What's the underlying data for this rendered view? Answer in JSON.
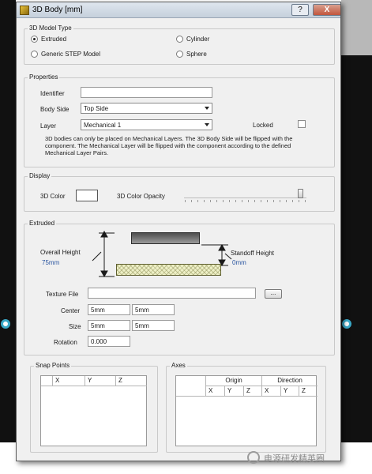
{
  "window": {
    "title": "3D Body [mm]",
    "help_label": "?",
    "close_label": "X"
  },
  "model_type": {
    "group_label": "3D Model Type",
    "options": [
      "Extruded",
      "Cylinder",
      "Generic STEP Model",
      "Sphere"
    ],
    "selected": "Extruded"
  },
  "properties": {
    "group_label": "Properties",
    "identifier_label": "Identifier",
    "identifier_value": "",
    "body_side_label": "Body Side",
    "body_side_value": "Top Side",
    "layer_label": "Layer",
    "layer_value": "Mechanical 1",
    "locked_label": "Locked",
    "note": "3D bodies can only be placed on Mechanical Layers. The 3D Body Side will be flipped with the component. The Mechanical Layer will be flipped with the component according to the defined Mechanical Layer Pairs."
  },
  "display": {
    "group_label": "Display",
    "color_label": "3D Color",
    "color_value": "#ffffff",
    "opacity_label": "3D Color Opacity",
    "opacity_fraction": 0.97
  },
  "extruded": {
    "group_label": "Extruded",
    "overall_height_label": "Overall Height",
    "overall_height_value": "75mm",
    "standoff_height_label": "Standoff Height",
    "standoff_height_value": "0mm",
    "texture_file_label": "Texture File",
    "texture_file_value": "",
    "browse_label": "...",
    "center_label": "Center",
    "center_x": "5mm",
    "center_y": "5mm",
    "size_label": "Size",
    "size_x": "5mm",
    "size_y": "5mm",
    "rotation_label": "Rotation",
    "rotation_value": "0.000"
  },
  "snap_points": {
    "group_label": "Snap Points",
    "columns": [
      "X",
      "Y",
      "Z"
    ]
  },
  "axes": {
    "group_label": "Axes",
    "origin_label": "Origin",
    "direction_label": "Direction",
    "columns": [
      "X",
      "Y",
      "Z",
      "X",
      "Y",
      "Z"
    ]
  },
  "watermark": {
    "text": "电源研发精英圈"
  }
}
